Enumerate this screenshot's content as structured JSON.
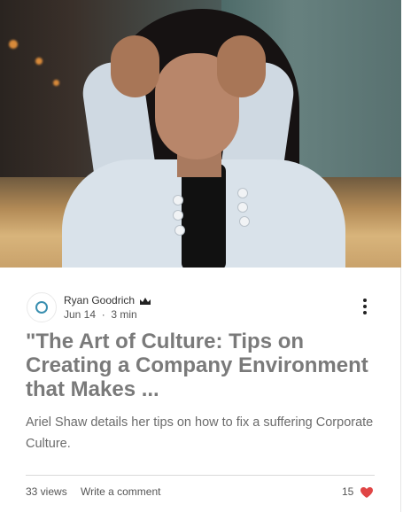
{
  "post": {
    "author": "Ryan Goodrich",
    "date": "Jun 14",
    "separator": "·",
    "read_time": "3 min",
    "title": "\"The Art of Culture: Tips on Creating a Company Environment that Makes ...",
    "excerpt": "Ariel Shaw details her tips on how to fix a suffering Corporate Culture."
  },
  "stats": {
    "views": "33 views",
    "comment_label": "Write a comment",
    "likes": "15"
  },
  "icons": {
    "crown": "crown-icon",
    "more": "more-vertical-icon",
    "like": "heart-icon"
  },
  "colors": {
    "heart": "#e04545",
    "title": "#7a7a7a"
  }
}
